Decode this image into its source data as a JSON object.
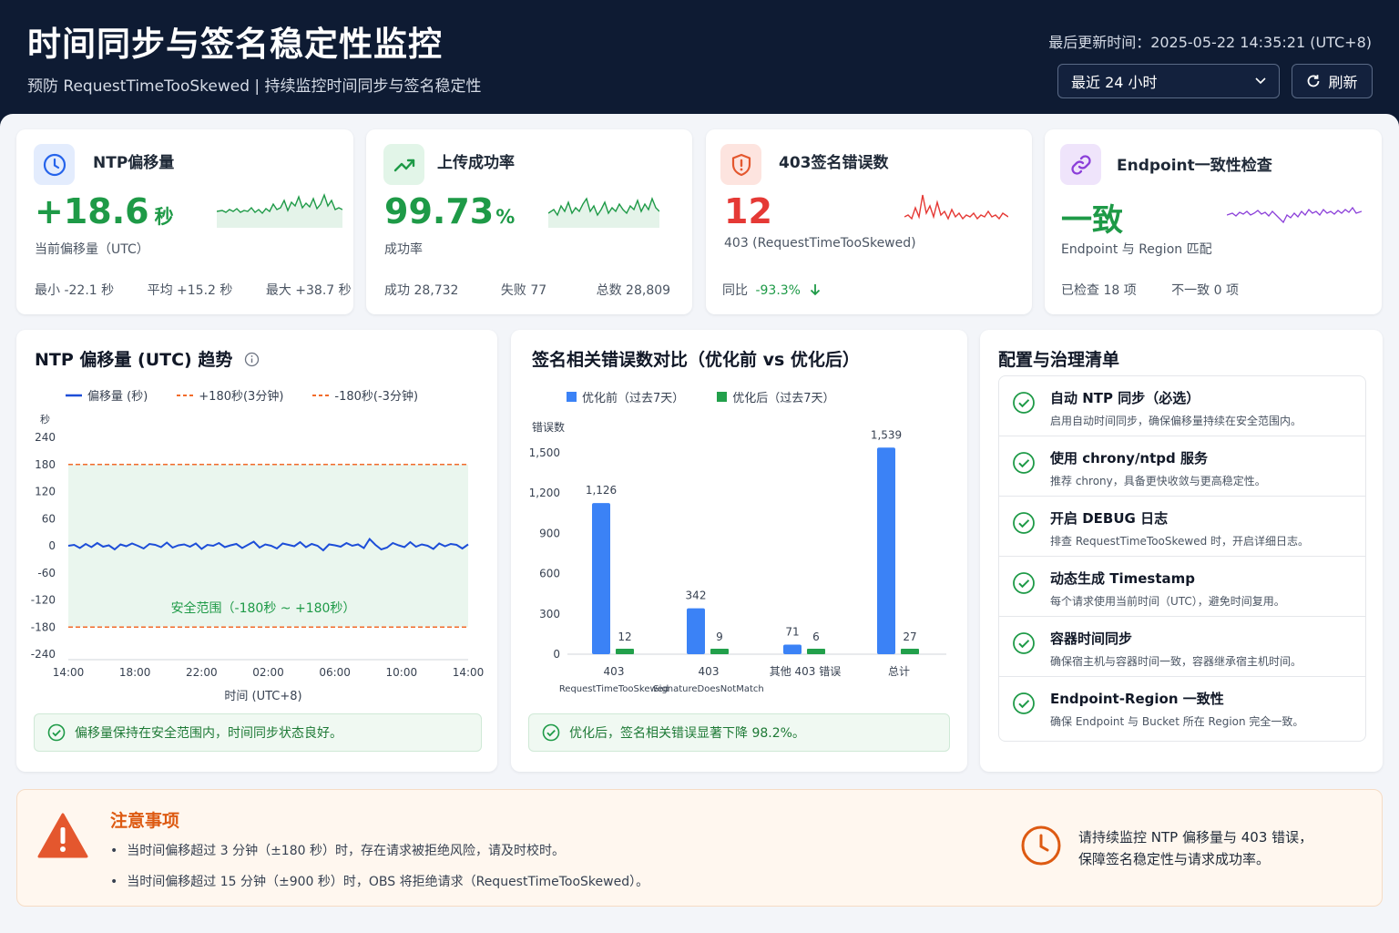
{
  "header": {
    "title": "时间同步与签名稳定性监控",
    "subtitle": "预防 RequestTimeTooSkewed | 持续监控时间同步与签名稳定性",
    "updated": "最后更新时间：2025-05-22 14:35:21 (UTC+8)",
    "range_select": "最近 24 小时",
    "refresh_label": "刷新"
  },
  "kpis": {
    "ntp": {
      "title": "NTP偏移量",
      "value": "+18.6",
      "unit": "秒",
      "label": "当前偏移量（UTC）",
      "min": "最小 -22.1 秒",
      "avg": "平均 +15.2 秒",
      "max": "最大 +38.7 秒",
      "color": "#1e9a47"
    },
    "upload": {
      "title": "上传成功率",
      "value": "99.73",
      "unit": "%",
      "label": "成功率",
      "success": "成功 28,732",
      "fail": "失败 77",
      "total": "总数 28,809",
      "color": "#1e9a47"
    },
    "err403": {
      "title": "403签名错误数",
      "value": "12",
      "label": "403 (RequestTimeTooSkewed)",
      "yoy_label": "同比",
      "yoy_value": "-93.3%",
      "color": "#e53935"
    },
    "endpoint": {
      "title": "Endpoint一致性检查",
      "value": "一致",
      "label": "Endpoint 与 Region 匹配",
      "checked": "已检查 18 项",
      "mismatch": "不一致 0 项",
      "color": "#1e9a47"
    }
  },
  "ntp_trend": {
    "title": "NTP 偏移量 (UTC) 趋势",
    "legend": [
      "偏移量 (秒)",
      "+180秒(3分钟)",
      "-180秒(-3分钟)"
    ],
    "y_unit": "秒",
    "xlabel": "时间 (UTC+8)",
    "safe_label": "安全范围（-180秒 ~ +180秒）",
    "status": "偏移量保持在安全范围内，时间同步状态良好。"
  },
  "err_compare": {
    "title": "签名相关错误数对比（优化前 vs 优化后）",
    "legend": [
      "优化前（过去7天）",
      "优化后（过去7天）"
    ],
    "ylabel": "错误数",
    "status": "优化后，签名相关错误显著下降 98.2%。"
  },
  "checklist": {
    "title": "配置与治理清单",
    "items": [
      {
        "title": "自动 NTP 同步（必选）",
        "desc": "启用自动时间同步，确保偏移量持续在安全范围内。"
      },
      {
        "title": "使用 chrony/ntpd 服务",
        "desc": "推荐 chrony，具备更快收敛与更高稳定性。"
      },
      {
        "title": "开启 DEBUG 日志",
        "desc": "排查 RequestTimeTooSkewed 时，开启详细日志。"
      },
      {
        "title": "动态生成 Timestamp",
        "desc": "每个请求使用当前时间（UTC），避免时间复用。"
      },
      {
        "title": "容器时间同步",
        "desc": "确保宿主机与容器时间一致，容器继承宿主机时间。"
      },
      {
        "title": "Endpoint-Region 一致性",
        "desc": "确保 Endpoint 与 Bucket 所在 Region 完全一致。"
      }
    ]
  },
  "notice": {
    "title": "注意事项",
    "items": [
      "当时间偏移超过 3 分钟（±180 秒）时，存在请求被拒绝风险，请及时校时。",
      "当时间偏移超过 15 分钟（±900 秒）时，OBS 将拒绝请求（RequestTimeTooSkewed）。"
    ],
    "right_line1": "请持续监控 NTP 偏移量与 403 错误，",
    "right_line2": "保障签名稳定性与请求成功率。"
  },
  "chart_data": [
    {
      "type": "line",
      "x": [
        "14:00",
        "18:00",
        "22:00",
        "02:00",
        "06:00",
        "10:00",
        "14:00"
      ],
      "series": [
        {
          "name": "偏移量 (秒)",
          "values": [
            0,
            2,
            -5,
            4,
            -3,
            6,
            -2,
            1,
            -8,
            3,
            -1,
            5,
            0,
            -6,
            4,
            2,
            -3,
            7,
            -4,
            1,
            3,
            -2,
            5,
            -7,
            2,
            0,
            6,
            -3,
            1,
            4,
            -5,
            2,
            9,
            -4,
            3,
            0,
            -6,
            5,
            2,
            -1,
            8,
            -3,
            4,
            0,
            -10,
            3,
            1,
            -2,
            6,
            0,
            3,
            -5,
            15,
            2,
            -8,
            -4,
            6,
            1,
            -3,
            8,
            -2,
            3,
            0,
            -7,
            5,
            -1,
            4,
            2,
            -6,
            3
          ]
        },
        {
          "name": "+180秒(3分钟)",
          "values": [
            180
          ]
        },
        {
          "name": "-180秒(-3分钟)",
          "values": [
            -180
          ]
        }
      ],
      "xlabel": "时间 (UTC+8)",
      "ylabel": "秒",
      "yticks": [
        240,
        180,
        120,
        60,
        0,
        -60,
        -120,
        -180,
        -240
      ],
      "ylim": [
        -240,
        240
      ]
    },
    {
      "type": "bar",
      "categories": [
        "403 RequestTimeTooSkewed",
        "403 SignatureDoesNotMatch",
        "其他 403 错误",
        "总计"
      ],
      "category_lines": [
        [
          "403",
          "RequestTimeTooSkewed"
        ],
        [
          "403",
          "SignatureDoesNotMatch"
        ],
        [
          "其他 403 错误"
        ],
        [
          "总计"
        ]
      ],
      "series": [
        {
          "name": "优化前（过去7天）",
          "values": [
            1126,
            342,
            71,
            1539
          ],
          "labels": [
            "1,126",
            "342",
            "71",
            "1,539"
          ],
          "color": "#3b82f6"
        },
        {
          "name": "优化后（过去7天）",
          "values": [
            12,
            9,
            6,
            27
          ],
          "labels": [
            "12",
            "9",
            "6",
            "27"
          ],
          "color": "#22a04b"
        }
      ],
      "ylabel": "错误数",
      "yticks": [
        "1,500",
        "1,200",
        "900",
        "600",
        "300",
        "0"
      ],
      "ylim": [
        0,
        1500
      ]
    }
  ]
}
